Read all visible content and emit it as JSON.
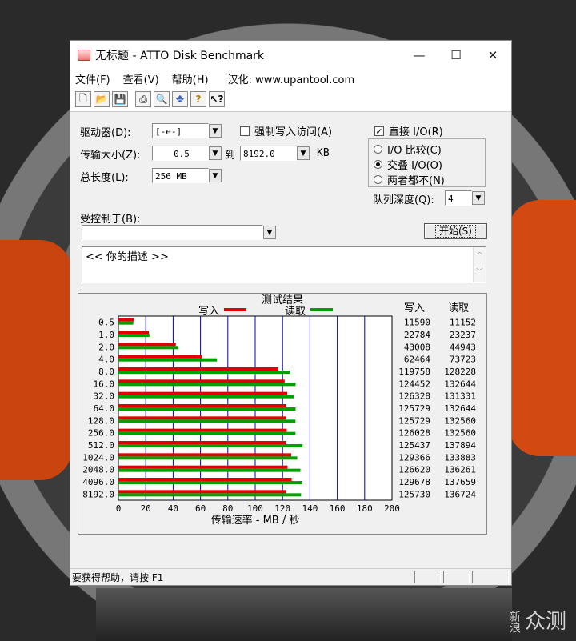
{
  "titlebar": {
    "title": "无标题 - ATTO Disk Benchmark",
    "minimize": "—",
    "maximize": "☐",
    "close": "✕"
  },
  "menu": {
    "file": "文件(F)",
    "view": "查看(V)",
    "help": "帮助(H)",
    "localized": "汉化: www.upantool.com"
  },
  "toolbar": {
    "icons": [
      "new-icon",
      "open-icon",
      "save-icon",
      "print-icon",
      "print-preview-icon",
      "move-icon",
      "help-icon",
      "context-help-icon"
    ]
  },
  "form": {
    "drive_label": "驱动器(D):",
    "drive_value": "[-e-]",
    "transfer_label": "传输大小(Z):",
    "transfer_from": "0.5",
    "to_label": "到",
    "transfer_to": "8192.0",
    "kb_label": "KB",
    "length_label": "总长度(L):",
    "length_value": "256 MB",
    "force_write_label": "强制写入访问(A)",
    "direct_io_label": "直接 I/O(R)",
    "io_compare_label": "I/O 比较(C)",
    "overlap_io_label": "交叠 I/O(O)",
    "neither_label": "两者都不(N)",
    "queue_label": "队列深度(Q):",
    "queue_value": "4",
    "controlled_label": "受控制于(B):",
    "controlled_value": "",
    "start_button": "开始(S)",
    "description": "<<  你的描述    >>"
  },
  "results": {
    "title": "测试结果",
    "legend_write": "写入",
    "legend_read": "读取",
    "col_write": "写入",
    "col_read": "读取",
    "xlabel": "传输速率 - MB / 秒",
    "ticks": [
      "0",
      "20",
      "40",
      "60",
      "80",
      "100",
      "120",
      "140",
      "160",
      "180",
      "200"
    ]
  },
  "status": {
    "text": "要获得帮助，请按 F1"
  },
  "watermark": {
    "small": "新浪",
    "big": "众测"
  },
  "colors": {
    "write": "#e00000",
    "read": "#00a000",
    "grid": "#0000c0"
  },
  "chart_data": {
    "type": "bar",
    "orientation": "horizontal",
    "title": "测试结果",
    "xlabel": "传输速率 - MB / 秒",
    "xlim": [
      0,
      200
    ],
    "categories": [
      "0.5",
      "1.0",
      "2.0",
      "4.0",
      "8.0",
      "16.0",
      "32.0",
      "64.0",
      "128.0",
      "256.0",
      "512.0",
      "1024.0",
      "2048.0",
      "4096.0",
      "8192.0"
    ],
    "series": [
      {
        "name": "写入",
        "values": [
          11590,
          22784,
          43008,
          62464,
          119758,
          124452,
          126328,
          125729,
          125729,
          126028,
          125437,
          129366,
          126620,
          129678,
          125730
        ]
      },
      {
        "name": "读取",
        "values": [
          11152,
          23237,
          44943,
          73723,
          128228,
          132644,
          131331,
          132644,
          132560,
          132560,
          137894,
          133883,
          136261,
          137659,
          136724
        ]
      }
    ],
    "grid": true,
    "legend": "top"
  }
}
